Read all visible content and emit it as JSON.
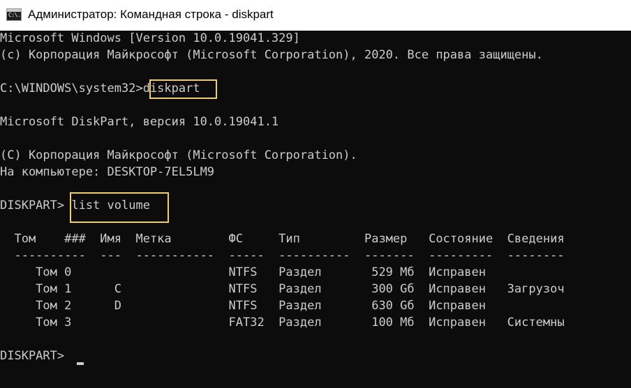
{
  "window": {
    "icon_name": "cmd-icon",
    "icon_text": "C:\\.",
    "title": "Администратор: Командная строка - diskpart"
  },
  "console": {
    "line1": "Microsoft Windows [Version 10.0.19041.329]",
    "line2": "(c) Корпорация Майкрософт (Microsoft Corporation), 2020. Все права защищены.",
    "prompt1": "C:\\WINDOWS\\system32>",
    "command1": "diskpart",
    "line4": "Microsoft DiskPart, версия 10.0.19041.1",
    "line5": "(C) Корпорация Майкрософт (Microsoft Corporation).",
    "line6": "На компьютере: DESKTOP-7EL5LM9",
    "prompt2": "DISKPART> ",
    "command2": "list volume",
    "table_header": "  Том    ###  Имя  Метка        ФС     Тип         Размер   Состояние  Сведения",
    "table_sep": "  ----------  ---  -----------  -----  ----------  -------  ---------  --------",
    "rows": [
      "     Том 0                      NTFS   Раздел       529 Мб  Исправен",
      "     Том 1      C               NTFS   Раздел       300 Gб  Исправен   Загрузоч",
      "     Том 2      D               NTFS   Раздел       630 Gб  Исправен",
      "     Том 3                      FAT32  Раздел       100 Мб  Исправен   Системны"
    ],
    "prompt3": "DISKPART> "
  },
  "colors": {
    "console_bg": "#0c0c0c",
    "console_text": "#cccccc",
    "highlight": "#f3d25b"
  }
}
